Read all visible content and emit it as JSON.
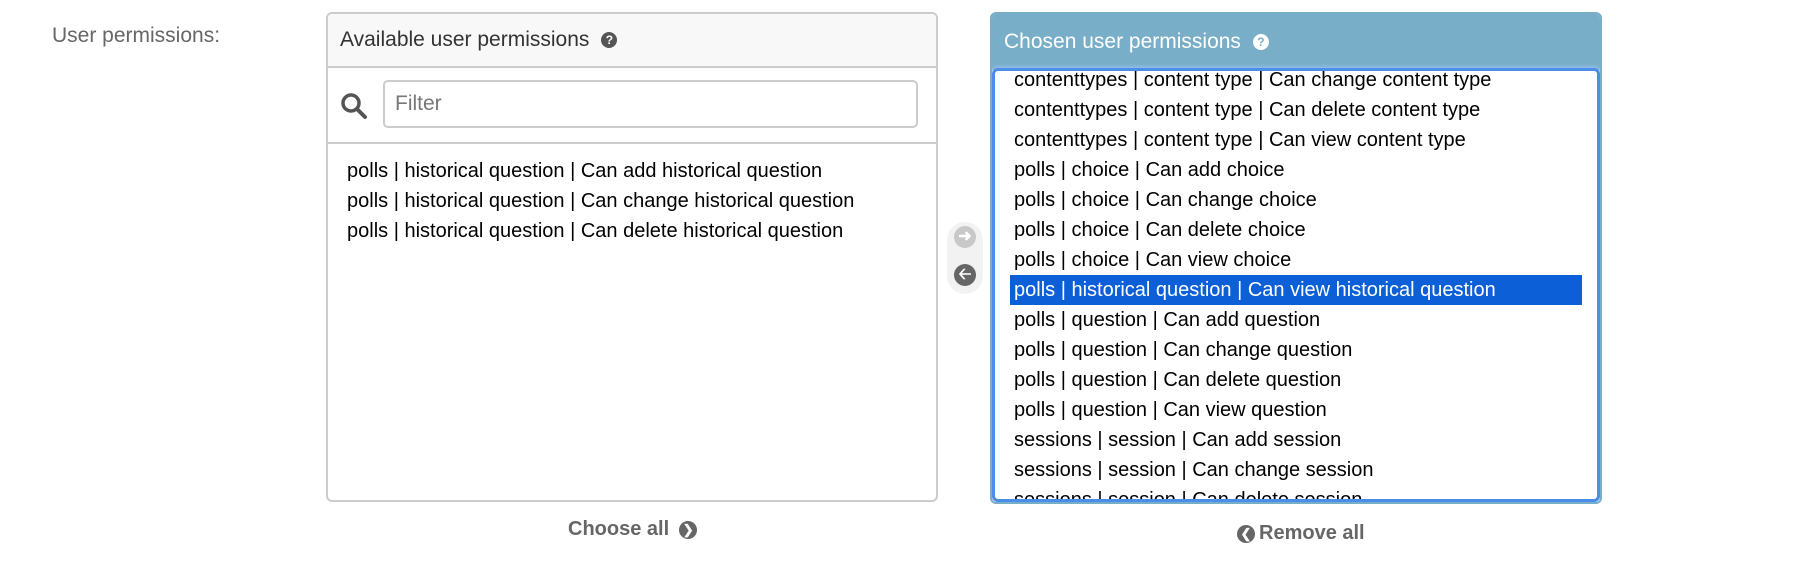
{
  "field": {
    "label": "User permissions:"
  },
  "available": {
    "title": "Available user permissions",
    "help_icon": "question-circle-icon",
    "filter_placeholder": "Filter",
    "filter_value": "",
    "search_icon": "search-icon",
    "options": [
      "polls | historical question | Can add historical question",
      "polls | historical question | Can change historical question",
      "polls | historical question | Can delete historical question"
    ],
    "choose_all_label": "Choose all",
    "choose_all_icon": "arrow-right-circle-icon"
  },
  "transfer": {
    "add_icon": "arrow-right-circle-icon",
    "remove_icon": "arrow-left-circle-icon"
  },
  "chosen": {
    "title": "Chosen user permissions",
    "help_icon": "question-circle-icon",
    "options": [
      "contenttypes | content type | Can change content type",
      "contenttypes | content type | Can delete content type",
      "contenttypes | content type | Can view content type",
      "polls | choice | Can add choice",
      "polls | choice | Can change choice",
      "polls | choice | Can delete choice",
      "polls | choice | Can view choice",
      "polls | historical question | Can view historical question",
      "polls | question | Can add question",
      "polls | question | Can change question",
      "polls | question | Can delete question",
      "polls | question | Can view question",
      "sessions | session | Can add session",
      "sessions | session | Can change session",
      "sessions | session | Can delete session"
    ],
    "selected_option": "polls | historical question | Can view historical question",
    "remove_all_label": "Remove all",
    "remove_all_icon": "arrow-left-circle-icon"
  },
  "colors": {
    "chosen_header": "#79aec8",
    "selection": "#0c5fd6",
    "focus_ring": "#4b8ee8"
  }
}
